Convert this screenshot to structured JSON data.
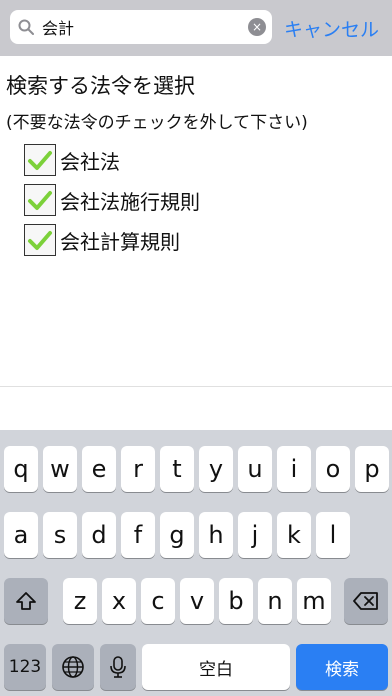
{
  "search": {
    "value": "会計",
    "clear_glyph": "×",
    "cancel_label": "キャンセル"
  },
  "content": {
    "title": "検索する法令を選択",
    "note": "(不要な法令のチェックを外して下さい)",
    "laws": [
      {
        "label": "会社法",
        "checked": true
      },
      {
        "label": "会社法施行規則",
        "checked": true
      },
      {
        "label": "会社計算規則",
        "checked": true
      }
    ],
    "check_color": "#7cd13a"
  },
  "keyboard": {
    "row1": [
      "q",
      "w",
      "e",
      "r",
      "t",
      "y",
      "u",
      "i",
      "o",
      "p"
    ],
    "row2": [
      "a",
      "s",
      "d",
      "f",
      "g",
      "h",
      "j",
      "k",
      "l"
    ],
    "row3": [
      "z",
      "x",
      "c",
      "v",
      "b",
      "n",
      "m"
    ],
    "numbers_label": "123",
    "space_label": "空白",
    "search_label": "検索"
  },
  "colors": {
    "accent": "#2a7ff3",
    "keyboard_bg": "#d1d4da",
    "function_key": "#abb0ba"
  },
  "icons": [
    "search-icon",
    "clear-icon",
    "shift-icon",
    "backspace-icon",
    "globe-icon",
    "microphone-icon",
    "checkmark-icon"
  ]
}
